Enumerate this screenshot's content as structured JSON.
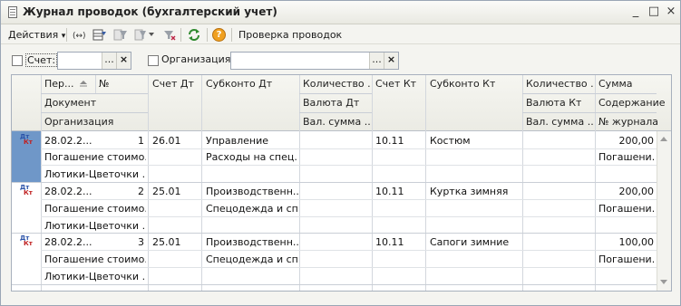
{
  "window": {
    "title": "Журнал проводок (бухгалтерский учет)",
    "min_glyph": "_",
    "max_glyph": "□",
    "close_glyph": "×"
  },
  "toolbar": {
    "actions_label": "Действия",
    "actions_arrow": "▾",
    "check_label": "Проверка проводок",
    "help_glyph": "?",
    "icons": [
      "exchange-icon",
      "table-settings-icon",
      "filter-icon",
      "filter-dropdown-icon",
      "filter-off-icon",
      "refresh-icon",
      "help-icon"
    ]
  },
  "filters": {
    "account_label": "Счет:",
    "account_value": "",
    "org_label": "Организация:",
    "org_value": "",
    "select_glyph": "...",
    "clear_glyph": "×"
  },
  "grid": {
    "headers": {
      "period": "Пер...",
      "number": "№",
      "document": "Документ",
      "organization": "Организация",
      "acc_dt": "Счет Дт",
      "subconto_dt": "Субконто Дт",
      "qty_dt": "Количество ...",
      "currency_dt": "Валюта Дт",
      "cur_sum_dt": "Вал. сумма ...",
      "acc_kt": "Счет Кт",
      "subconto_kt": "Субконто Кт",
      "qty_kt": "Количество ...",
      "currency_kt": "Валюта Кт",
      "cur_sum_kt": "Вал. сумма ...",
      "sum": "Сумма",
      "content": "Содержание",
      "journal_no": "№ журнала"
    },
    "icon_dt": "Дт",
    "icon_kt": "Кт",
    "rows": [
      {
        "period": "28.02.2...",
        "number": "1",
        "document": "Погашение стоимо...",
        "organization": "Лютики-Цветочки ...",
        "acc_dt": "26.01",
        "subconto_dt_1": "Управление",
        "subconto_dt_2": "Расходы на спец...",
        "acc_kt": "10.11",
        "subconto_kt_1": "Костюм",
        "sum": "200,00",
        "content": "Погашени..."
      },
      {
        "period": "28.02.2...",
        "number": "2",
        "document": "Погашение стоимо...",
        "organization": "Лютики-Цветочки ...",
        "acc_dt": "25.01",
        "subconto_dt_1": "Производственн...",
        "subconto_dt_2": "Спецодежда и сп...",
        "acc_kt": "10.11",
        "subconto_kt_1": "Куртка зимняя",
        "sum": "200,00",
        "content": "Погашени..."
      },
      {
        "period": "28.02.2...",
        "number": "3",
        "document": "Погашение стоимо...",
        "organization": "Лютики-Цветочки ...",
        "acc_dt": "25.01",
        "subconto_dt_1": "Производственн...",
        "subconto_dt_2": "Спецодежда и сп...",
        "acc_kt": "10.11",
        "subconto_kt_1": "Сапоги зимние",
        "sum": "100,00",
        "content": "Погашени..."
      }
    ]
  },
  "colors": {
    "selection": "#6f97c8",
    "dt_icon": "#2a52a8",
    "kt_icon": "#c02020"
  }
}
